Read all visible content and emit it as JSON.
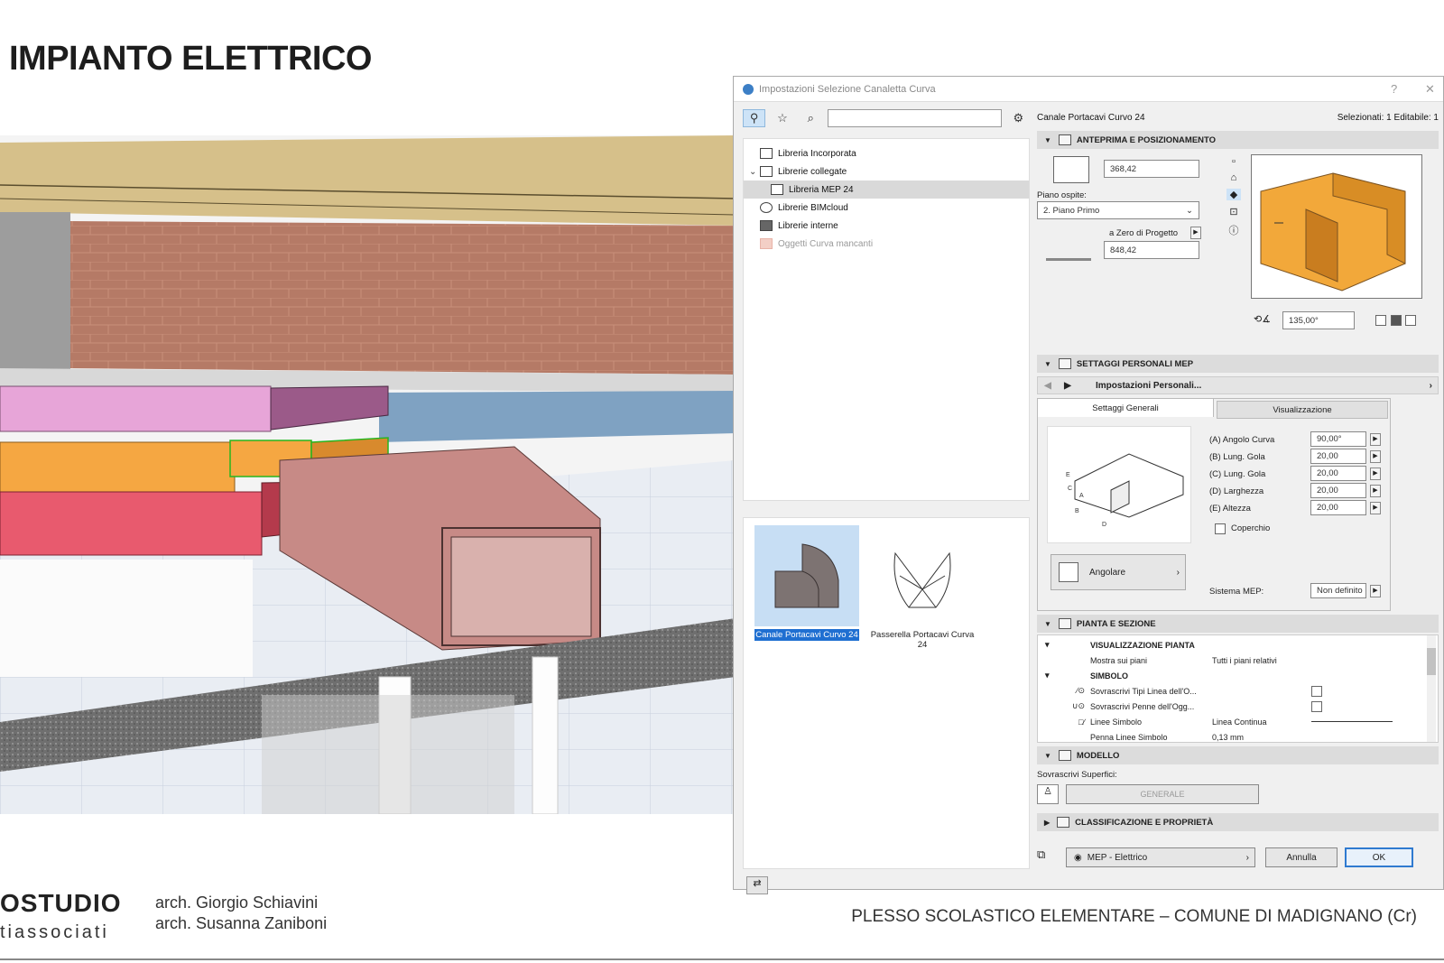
{
  "slide": {
    "title": "IMPIANTO ELETTRICO",
    "footer_logo_line1": "OSTUDIO",
    "footer_logo_line2": "tiassociati",
    "architects": [
      "arch. Giorgio  Schiavini",
      "arch. Susanna Zaniboni"
    ],
    "project": "PLESSO SCOLASTICO  ELEMENTARE – COMUNE  DI MADIGNANO  (Cr)"
  },
  "dialog": {
    "title": "Impostazioni Selezione Canaletta Curva",
    "help_label": "?",
    "close_label": "✕",
    "search_placeholder": "",
    "tree": [
      {
        "label": "Libreria Incorporata",
        "icon": "library-icon"
      },
      {
        "label": "Librerie collegate",
        "icon": "linked-library-icon"
      },
      {
        "label": "Libreria MEP 24",
        "icon": "folder-icon"
      },
      {
        "label": "Librerie BIMcloud",
        "icon": "bimcloud-icon"
      },
      {
        "label": "Librerie interne",
        "icon": "folder-icon"
      },
      {
        "label": "Oggetti Curva mancanti",
        "icon": "missing-folder-icon"
      }
    ],
    "thumbnails": [
      {
        "label": "Canale Portacavi Curvo 24"
      },
      {
        "label": "Passerella Portacavi Curva 24"
      }
    ],
    "object_name": "Canale Portacavi Curvo 24",
    "selection_info": "Selezionati: 1 Editabile: 1",
    "sections": {
      "preview": "ANTEPRIMA E POSIZIONAMENTO",
      "mep": "SETTAGGI PERSONALI MEP",
      "plan": "PIANTA E SEZIONE",
      "model": "MODELLO",
      "class": "CLASSIFICAZIONE E PROPRIETÀ"
    },
    "elevation_value": "368,42",
    "host_story_label": "Piano ospite:",
    "host_story_value": "2. Piano Primo",
    "zero_label": "a Zero di Progetto",
    "zero_value": "848,42",
    "rotation_value": "135,00°",
    "custom_settings": "Impostazioni Personali...",
    "tabs": [
      "Settaggi Generali",
      "Visualizzazione"
    ],
    "params": [
      {
        "label": "(A) Angolo Curva",
        "value": "90,00°"
      },
      {
        "label": "(B) Lung. Gola",
        "value": "20,00"
      },
      {
        "label": "(C) Lung. Gola",
        "value": "20,00"
      },
      {
        "label": "(D) Larghezza",
        "value": "20,00"
      },
      {
        "label": "(E) Altezza",
        "value": "20,00"
      }
    ],
    "cover_label": "Coperchio",
    "shape_label": "Angolare",
    "mep_system_label": "Sistema MEP:",
    "mep_system_value": "Non definito",
    "plan_rows": {
      "group1": "VISUALIZZAZIONE PIANTA",
      "show_on": "Mostra sui piani",
      "show_on_value": "Tutti i piani relativi",
      "group2": "SIMBOLO",
      "r1": "Sovrascrivi Tipi Linea dell'O...",
      "r2": "Sovrascrivi Penne dell'Ogg...",
      "r3": "Linee Simbolo",
      "r3_value": "Linea Continua",
      "r4": "Penna Linee Simbolo",
      "r4_value": "0,13 mm"
    },
    "surface_override_label": "Sovrascrivi Superfici:",
    "surface_value": "GENERALE",
    "layer_value": "MEP - Elettrico",
    "cancel_label": "Annulla",
    "ok_label": "OK"
  },
  "colors": {
    "pink_tray": "#e7a5d8",
    "orange_tray": "#f5a742",
    "red_tray": "#e85a6e",
    "duct": "#c78a86",
    "preview_orange": "#f2a83a",
    "ok_border": "#2f7ad0",
    "selected_thumb": "#c7def4"
  }
}
